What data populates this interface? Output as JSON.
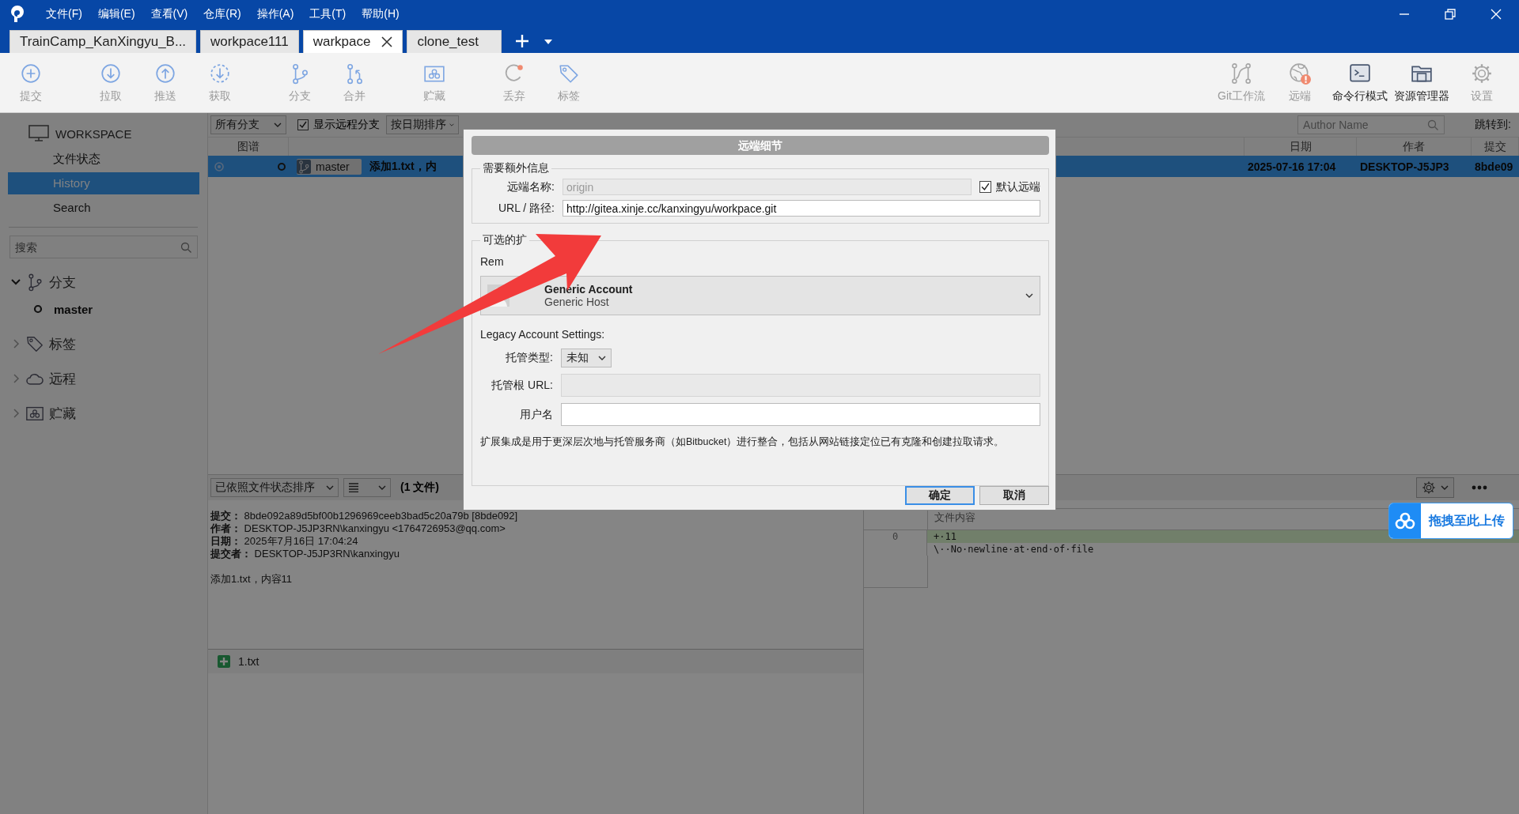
{
  "menu": [
    "文件(F)",
    "编辑(E)",
    "查看(V)",
    "仓库(R)",
    "操作(A)",
    "工具(T)",
    "帮助(H)"
  ],
  "repo_tabs": [
    {
      "label": "TrainCamp_KanXingyu_B...",
      "selected": false
    },
    {
      "label": "workpace111",
      "selected": false
    },
    {
      "label": "warkpace",
      "selected": true
    },
    {
      "label": "clone_test",
      "selected": false
    }
  ],
  "toolbar": {
    "left_groups": [
      [
        {
          "label": "提交",
          "kind": "commit",
          "disabled": true
        }
      ],
      [
        {
          "label": "拉取",
          "kind": "pull",
          "disabled": true
        },
        {
          "label": "推送",
          "kind": "push",
          "disabled": true
        },
        {
          "label": "获取",
          "kind": "fetch",
          "disabled": true
        }
      ],
      [
        {
          "label": "分支",
          "kind": "branch",
          "disabled": true
        },
        {
          "label": "合并",
          "kind": "merge",
          "disabled": true
        }
      ],
      [
        {
          "label": "贮藏",
          "kind": "stash",
          "disabled": true
        }
      ],
      [
        {
          "label": "丢弃",
          "kind": "discard",
          "disabled": true
        },
        {
          "label": "标签",
          "kind": "tag",
          "disabled": true
        }
      ]
    ],
    "right": [
      {
        "label": "Git工作流",
        "kind": "gitflow",
        "disabled": true
      },
      {
        "label": "远端",
        "kind": "remote",
        "disabled": true
      },
      {
        "label": "命令行模式",
        "kind": "terminal",
        "disabled": false
      },
      {
        "label": "资源管理器",
        "kind": "explorer",
        "disabled": false
      },
      {
        "label": "设置",
        "kind": "settings",
        "disabled": true
      }
    ]
  },
  "sidebar": {
    "workspace_title": "WORKSPACE",
    "workspace_items": [
      {
        "label": "文件状态",
        "selected": false
      },
      {
        "label": "History",
        "selected": true
      },
      {
        "label": "Search",
        "selected": false
      }
    ],
    "search": {
      "placeholder": "搜索"
    },
    "tree": [
      {
        "label": "分支",
        "kind": "branch",
        "expanded": true,
        "children": [
          {
            "label": "master",
            "current": true
          }
        ]
      },
      {
        "label": "标签",
        "kind": "tag",
        "expanded": false
      },
      {
        "label": "远程",
        "kind": "remote",
        "expanded": false
      },
      {
        "label": "贮藏",
        "kind": "stash",
        "expanded": false
      }
    ]
  },
  "history": {
    "branch_filter": "所有分支",
    "show_remote": {
      "label": "显示远程分支",
      "checked": true
    },
    "sort": "按日期排序",
    "author_search": {
      "placeholder": "Author Name"
    },
    "jump_label": "跳转到:",
    "columns": [
      "图谱",
      "日期",
      "作者",
      "提交"
    ],
    "rows": [
      {
        "branch": "master",
        "message": "添加1.txt，内",
        "date": "2025-07-16 17:04",
        "author": "DESKTOP-J5JP3",
        "commit": "8bde09",
        "selected": true
      }
    ]
  },
  "details": {
    "sort": "已依照文件状态排序",
    "file_count": "(1 文件)",
    "commit_info": [
      {
        "label": "提交：",
        "value": "8bde092a89d5bf00b1296969ceeb3bad5c20a79b [8bde092]"
      },
      {
        "label": "作者：",
        "value": "DESKTOP-J5JP3RN\\kanxingyu <1764726953@qq.com>"
      },
      {
        "label": "日期：",
        "value": "2025年7月16日 17:04:24"
      },
      {
        "label": "提交者：",
        "value": "DESKTOP-J5JP3RN\\kanxingyu"
      }
    ],
    "message": "添加1.txt，内容11",
    "files": [
      {
        "name": "1.txt",
        "kind": "added"
      }
    ]
  },
  "diff": {
    "header": "文件内容",
    "lines": [
      {
        "line_no": "0",
        "text": "+·11",
        "kind": "added"
      },
      {
        "text": "\\··No·newline·at·end·of·file",
        "kind": "context"
      }
    ]
  },
  "upload_badge": "拖拽至此上传",
  "dialog": {
    "title": "远端细节",
    "required_group": "需要额外信息",
    "remote_name": {
      "label": "远端名称:",
      "value": "origin",
      "disabled": true
    },
    "default_remote": {
      "label": "默认远端",
      "checked": true
    },
    "url": {
      "label": "URL / 路径:",
      "value": "http://gitea.xinje.cc/kanxingyu/workpace.git",
      "disabled": false
    },
    "optional_group": "可选的扩",
    "remote_account_label": "Rem",
    "account": {
      "name": "Generic Account",
      "host": "Generic Host"
    },
    "legacy_title": "Legacy Account Settings:",
    "host_type": {
      "label": "托管类型:",
      "value": "未知"
    },
    "host_root": {
      "label": "托管根 URL:",
      "disabled": true
    },
    "username": {
      "label": "用户名",
      "disabled": false
    },
    "note": "扩展集成是用于更深层次地与托管服务商（如Bitbucket）进行整合，包括从网站链接定位已有克隆和创建拉取请求。",
    "buttons": [
      {
        "label": "确定",
        "default": true
      },
      {
        "label": "取消",
        "default": false
      }
    ]
  }
}
